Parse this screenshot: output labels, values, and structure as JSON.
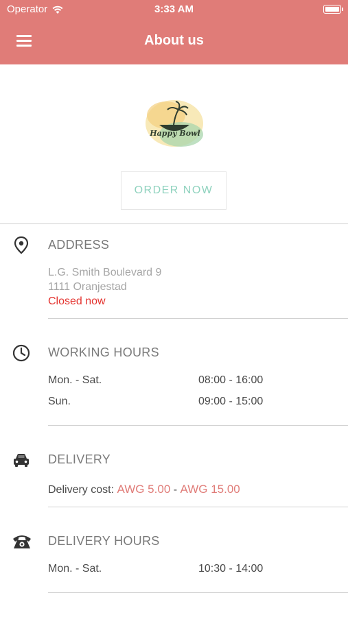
{
  "status_bar": {
    "carrier": "Operator",
    "time": "3:33 AM"
  },
  "header": {
    "title": "About us",
    "menu_icon": "menu-icon"
  },
  "logo": {
    "text": "Happy Bowl"
  },
  "order_button": {
    "label": "ORDER NOW"
  },
  "address": {
    "title": "ADDRESS",
    "line1": "L.G. Smith Boulevard 9",
    "line2": "1111 Oranjestad",
    "status": "Closed now"
  },
  "working_hours": {
    "title": "WORKING HOURS",
    "rows": [
      {
        "days": "Mon. - Sat.",
        "hours": "08:00 - 16:00"
      },
      {
        "days": "Sun.",
        "hours": "09:00 - 15:00"
      }
    ]
  },
  "delivery": {
    "title": "DELIVERY",
    "cost_label": "Delivery cost:",
    "min": "AWG 5.00",
    "separator": "-",
    "max": "AWG 15.00"
  },
  "delivery_hours": {
    "title": "DELIVERY HOURS",
    "rows": [
      {
        "days": "Mon. - Sat.",
        "hours": "10:30 - 14:00"
      }
    ]
  },
  "colors": {
    "header": "#e07c78",
    "accent_green": "#8fd2be",
    "closed_red": "#e4332f",
    "price": "#e07c78"
  }
}
